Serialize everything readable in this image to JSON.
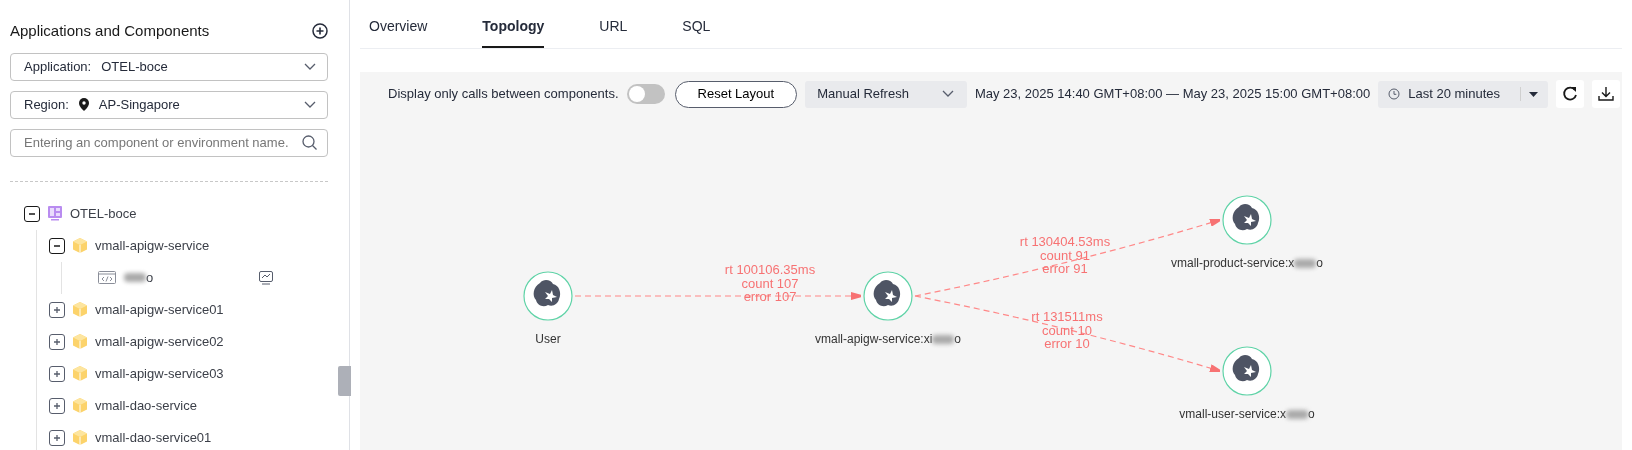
{
  "sidebar": {
    "title": "Applications and Components",
    "application": {
      "label": "Application:",
      "value": "OTEL-boce"
    },
    "region": {
      "label": "Region:",
      "value": "AP-Singapore"
    },
    "search": {
      "placeholder": "Entering an component or environment name."
    },
    "tree": [
      {
        "kind": "application",
        "label": "OTEL-boce",
        "expanded": true,
        "children": [
          {
            "kind": "component",
            "label": "vmall-apigw-service",
            "expanded": true,
            "children": [
              {
                "kind": "environment",
                "tail": "o"
              }
            ]
          },
          {
            "kind": "component",
            "label": "vmall-apigw-service01",
            "expanded": false
          },
          {
            "kind": "component",
            "label": "vmall-apigw-service02",
            "expanded": false
          },
          {
            "kind": "component",
            "label": "vmall-apigw-service03",
            "expanded": false
          },
          {
            "kind": "component",
            "label": "vmall-dao-service",
            "expanded": false
          },
          {
            "kind": "component",
            "label": "vmall-dao-service01",
            "expanded": false
          }
        ]
      }
    ]
  },
  "tabs": [
    {
      "label": "Overview",
      "selected": false
    },
    {
      "label": "Topology",
      "selected": true
    },
    {
      "label": "URL",
      "selected": false
    },
    {
      "label": "SQL",
      "selected": false
    }
  ],
  "toolbar": {
    "toggle_label": "Display only calls between components.",
    "toggle_on": false,
    "reset_button": "Reset Layout",
    "refresh_mode": "Manual Refresh",
    "time_range": "May 23, 2025 14:40 GMT+08:00 — May 23, 2025 15:00 GMT+08:00",
    "time_preset": "Last 20 minutes"
  },
  "topology": {
    "nodes": [
      {
        "label": "User"
      },
      {
        "label": "vmall-apigw-service:xi",
        "tail": "o"
      },
      {
        "label": "vmall-product-service:x",
        "tail": "o"
      },
      {
        "label": "vmall-user-service:x",
        "tail": "o"
      }
    ],
    "edges": [
      {
        "lines": [
          "rt 100106.35ms",
          "count 107",
          "error 107"
        ]
      },
      {
        "lines": [
          "rt 130404.53ms",
          "count 91",
          "error 91"
        ]
      },
      {
        "lines": [
          "rt 131511ms",
          "count 10",
          "error 10"
        ]
      }
    ]
  }
}
